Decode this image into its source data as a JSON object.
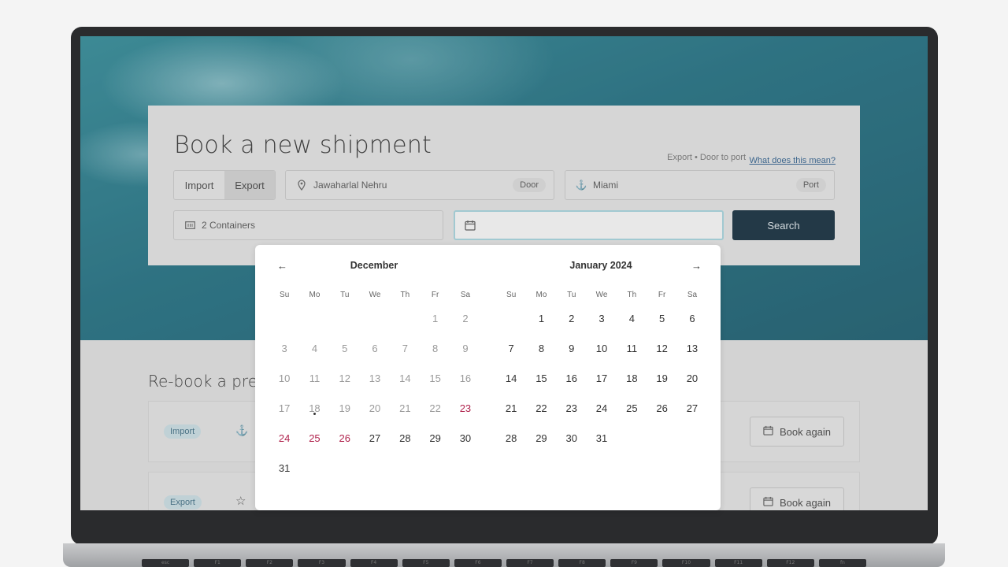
{
  "booking": {
    "title": "Book a new shipment",
    "hint": "Export • Door to port",
    "hint_link": "What does this mean?",
    "mode_options": [
      "Import",
      "Export"
    ],
    "origin": {
      "value": "Jawaharlal Nehru",
      "pill": "Door"
    },
    "destination": {
      "value": "Miami",
      "pill": "Port"
    },
    "containers": "2 Containers",
    "search_label": "Search"
  },
  "rebook": {
    "title": "Re-book a previous shipment",
    "rows": [
      {
        "tag": "Import",
        "button": "Book again"
      },
      {
        "tag": "Export",
        "button": "Book again"
      }
    ]
  },
  "calendar": {
    "weekdays": [
      "Su",
      "Mo",
      "Tu",
      "We",
      "Th",
      "Fr",
      "Sa"
    ],
    "months": [
      {
        "title": "December",
        "leading_blanks": 5,
        "days": 31,
        "today": 18,
        "past_through": 22,
        "holidays": [
          23,
          24,
          25,
          26
        ]
      },
      {
        "title": "January 2024",
        "leading_blanks": 1,
        "days": 31,
        "today": null,
        "past_through": 0,
        "holidays": []
      }
    ]
  },
  "keyboard": [
    "esc",
    "F1",
    "F2",
    "F3",
    "F4",
    "F5",
    "F6",
    "F7",
    "F8",
    "F9",
    "F10",
    "F11",
    "F12",
    "fn"
  ]
}
